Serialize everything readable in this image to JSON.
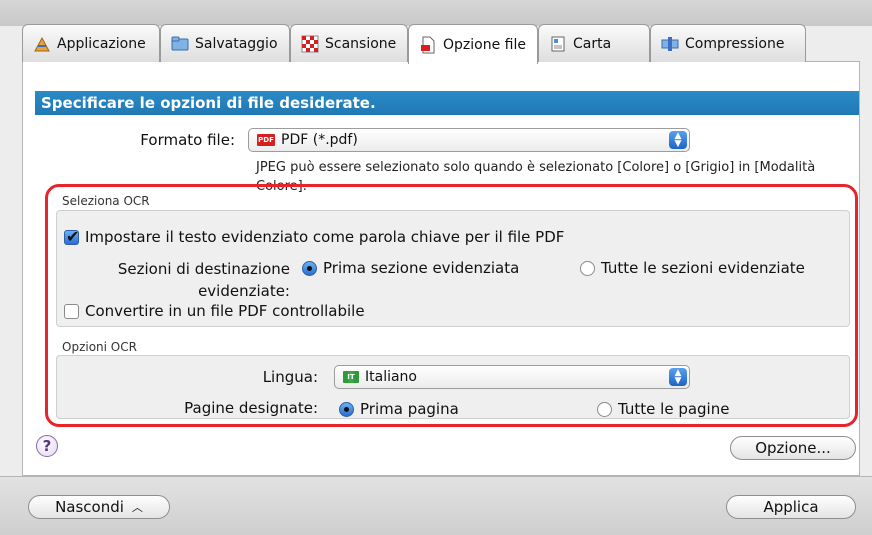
{
  "tabs": [
    {
      "label": "Applicazione",
      "icon": "application-icon",
      "active": false
    },
    {
      "label": "Salvataggio",
      "icon": "folder-icon",
      "active": false
    },
    {
      "label": "Scansione",
      "icon": "scan-icon",
      "active": false
    },
    {
      "label": "Opzione file",
      "icon": "file-option-icon",
      "active": true
    },
    {
      "label": "Carta",
      "icon": "paper-icon",
      "active": false
    },
    {
      "label": "Compressione",
      "icon": "compression-icon",
      "active": false
    }
  ],
  "banner": "Specificare le opzioni di file desiderate.",
  "file_format": {
    "label": "Formato file:",
    "value": "PDF (*.pdf)",
    "badge": "PDF",
    "note": "JPEG può essere selezionato solo quando è selezionato [Colore] o [Grigio] in [Modalità Colore]."
  },
  "select_ocr": {
    "title": "Seleziona OCR",
    "keyword_check": "Impostare il testo evidenziato come parola chiave per il file PDF",
    "keyword_checked": true,
    "target_label": "Sezioni di destinazione evidenziate:",
    "radio_first": "Prima sezione evidenziata",
    "radio_all": "Tutte le sezioni evidenziate",
    "searchable_check": "Convertire in un file PDF controllabile",
    "searchable_checked": false
  },
  "ocr_options": {
    "title": "Opzioni OCR",
    "language_label": "Lingua:",
    "language_value": "Italiano",
    "language_badge": "IT",
    "pages_label": "Pagine designate:",
    "radio_first_page": "Prima pagina",
    "radio_all_pages": "Tutte le pagine"
  },
  "buttons": {
    "help": "?",
    "option": "Opzione...",
    "hide": "Nascondi",
    "apply": "Applica"
  },
  "colors": {
    "banner": "#1f78b4",
    "highlight": "#e8242b"
  }
}
